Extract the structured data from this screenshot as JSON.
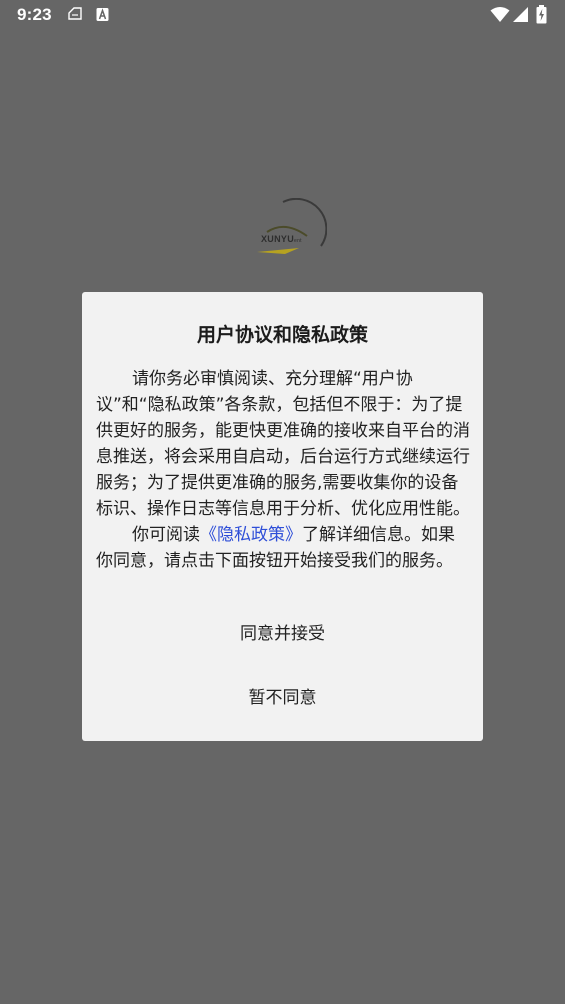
{
  "status_bar": {
    "time": "9:23",
    "left_icons": [
      "notification-icon",
      "text-a-icon"
    ],
    "right_icons": [
      "wifi-icon",
      "cellular-signal-icon",
      "battery-charging-icon"
    ]
  },
  "splash": {
    "logo_text": "XUNYU",
    "logo_suffix": "ent"
  },
  "dialog": {
    "title": "用户协议和隐私政策",
    "paragraph1": "请你务必审慎阅读、充分理解“用户协议”和“隐私政策”各条款，包括但不限于：为了提供更好的服务，能更快更准确的接收来自平台的消息推送，将会采用自启动，后台运行方式继续运行服务；为了提供更准确的服务,需要收集你的设备标识、操作日志等信息用于分析、优化应用性能。",
    "paragraph2_before": "你可阅读",
    "paragraph2_link": "《隐私政策》",
    "paragraph2_after": "了解详细信息。如果你同意，请点击下面按钮开始接受我们的服务。",
    "accept_label": "同意并接受",
    "decline_label": "暂不同意"
  },
  "colors": {
    "background": "#666666",
    "dialog_background": "#f2f2f2",
    "link": "#2f4fd8"
  }
}
